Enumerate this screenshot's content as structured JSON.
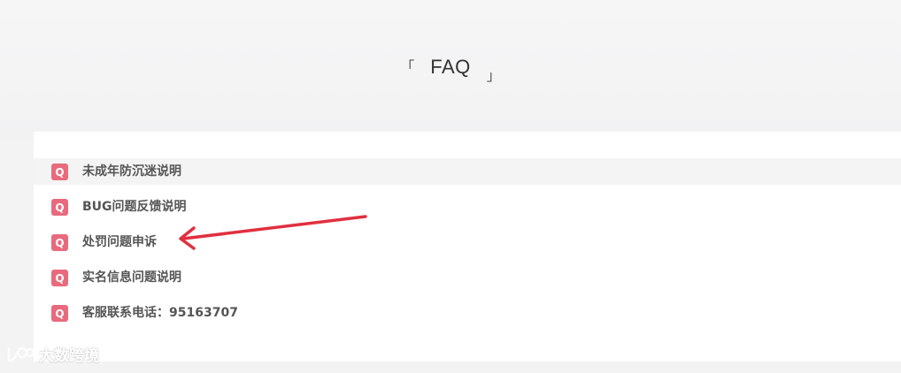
{
  "header": {
    "bracket_open": "「",
    "title": "FAQ",
    "bracket_close": "」"
  },
  "faq": {
    "badge": "Q",
    "items": [
      {
        "label": "未成年防沉迷说明",
        "active": true
      },
      {
        "label": "BUG问题反馈说明"
      },
      {
        "label": "处罚问题申诉"
      },
      {
        "label": "实名信息问题说明"
      },
      {
        "label": "客服联系电话：95163707"
      }
    ]
  },
  "annotation": {
    "arrow_color": "#e0303f",
    "points_to": "处罚问题申诉"
  },
  "watermark": {
    "text": "大数跨境"
  },
  "colors": {
    "badge": "#e96a7d",
    "label": "#555555",
    "panel": "#ffffff",
    "background": "#f3f3f4"
  }
}
